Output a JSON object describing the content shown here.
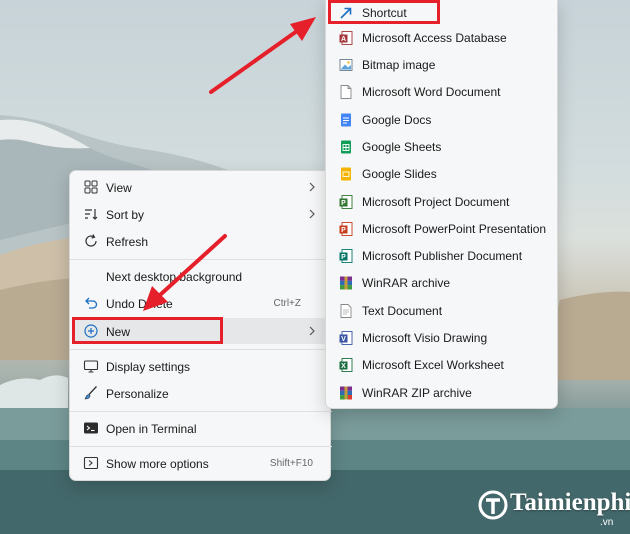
{
  "context_menu": {
    "items": [
      {
        "label": "View",
        "icon": "grid-icon",
        "submenu": true
      },
      {
        "label": "Sort by",
        "icon": "sort-icon",
        "submenu": true
      },
      {
        "label": "Refresh",
        "icon": "refresh-icon"
      },
      {
        "label": "Next desktop background",
        "icon": ""
      },
      {
        "label": "Undo Delete",
        "icon": "undo-icon",
        "shortcut": "Ctrl+Z"
      },
      {
        "label": "New",
        "icon": "plus-circle-icon",
        "submenu": true,
        "highlighted": true
      },
      {
        "label": "Display settings",
        "icon": "display-icon"
      },
      {
        "label": "Personalize",
        "icon": "brush-icon"
      },
      {
        "label": "Open in Terminal",
        "icon": "terminal-icon"
      },
      {
        "label": "Show more options",
        "icon": "more-options-icon",
        "shortcut": "Shift+F10"
      }
    ]
  },
  "new_submenu": {
    "items": [
      {
        "label": "Shortcut",
        "icon": "shortcut-icon",
        "highlighted": true
      },
      {
        "label": "Microsoft Access Database",
        "icon": "access-icon"
      },
      {
        "label": "Bitmap image",
        "icon": "bitmap-icon"
      },
      {
        "label": "Microsoft Word Document",
        "icon": "word-icon"
      },
      {
        "label": "Google Docs",
        "icon": "google-docs-icon"
      },
      {
        "label": "Google Sheets",
        "icon": "google-sheets-icon"
      },
      {
        "label": "Google Slides",
        "icon": "google-slides-icon"
      },
      {
        "label": "Microsoft Project Document",
        "icon": "project-icon"
      },
      {
        "label": "Microsoft PowerPoint Presentation",
        "icon": "powerpoint-icon"
      },
      {
        "label": "Microsoft Publisher Document",
        "icon": "publisher-icon"
      },
      {
        "label": "WinRAR archive",
        "icon": "winrar-icon"
      },
      {
        "label": "Text Document",
        "icon": "text-document-icon"
      },
      {
        "label": "Microsoft Visio Drawing",
        "icon": "visio-icon"
      },
      {
        "label": "Microsoft Excel Worksheet",
        "icon": "excel-icon"
      },
      {
        "label": "WinRAR ZIP archive",
        "icon": "winrar-zip-icon"
      }
    ]
  },
  "watermark": {
    "name": "Taimienphi",
    "suffix": ".vn"
  },
  "colors": {
    "annotation_red": "#e5202b",
    "menu_bg": "#f6f7f8"
  }
}
